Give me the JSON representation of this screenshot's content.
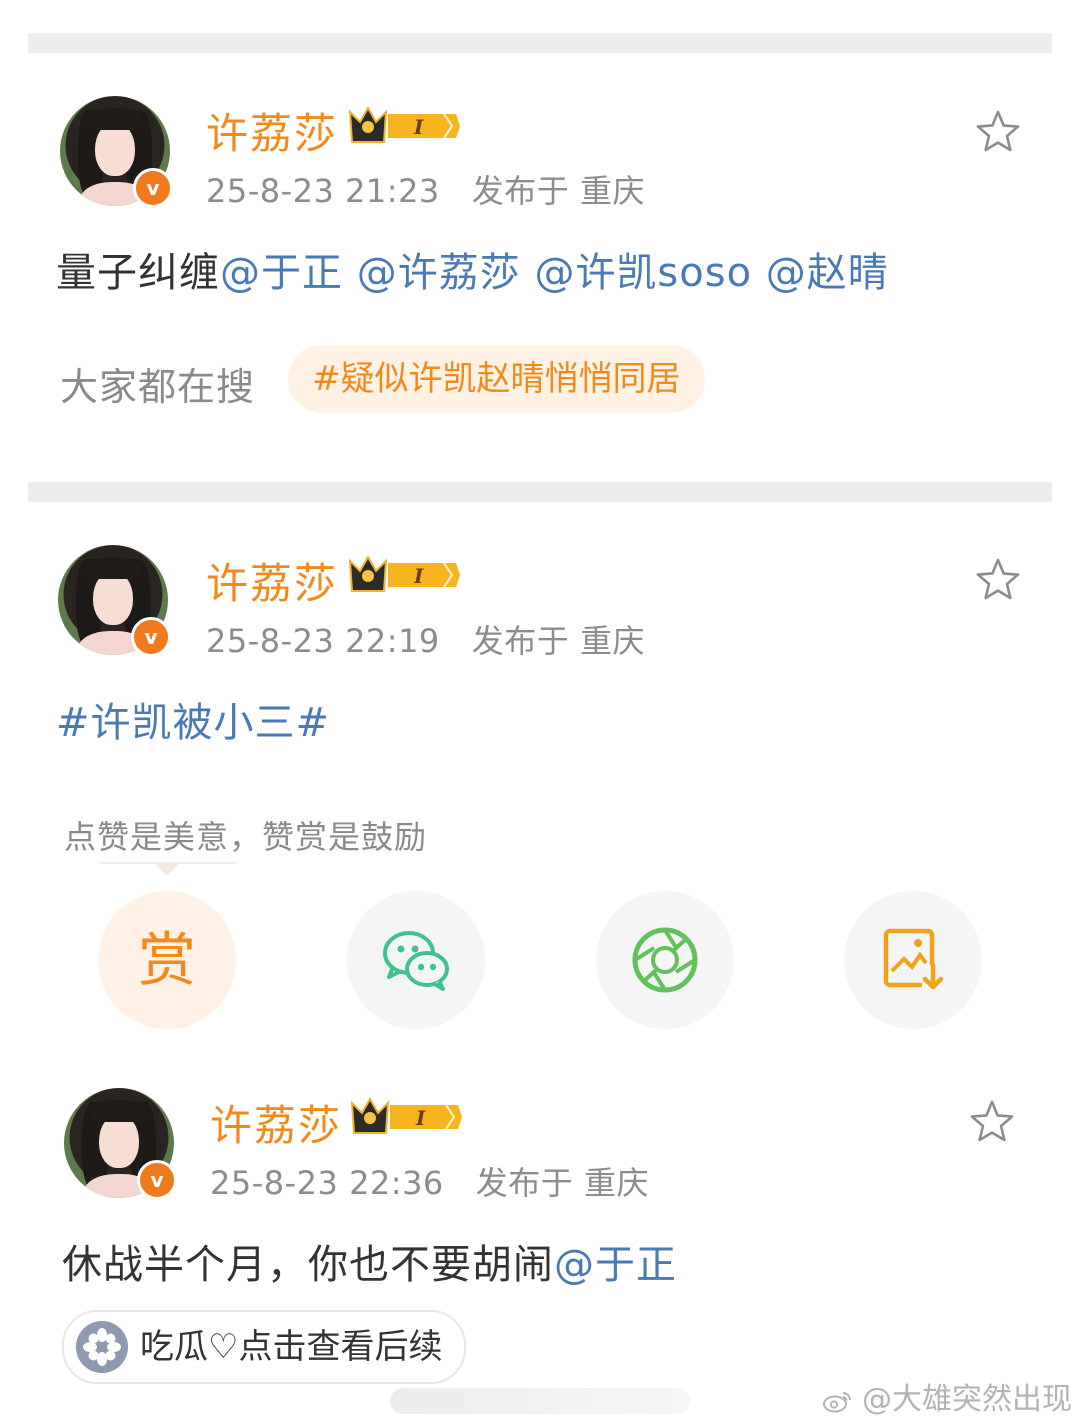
{
  "posts": [
    {
      "username": "许荔莎",
      "badge_level": "I",
      "verified_mark": "v",
      "timestamp": "25-8-23 21:23",
      "location": "发布于 重庆",
      "content_plain": "量子纠缠",
      "mentions": [
        "@于正",
        "@许荔莎",
        "@许凯soso",
        "@赵晴"
      ],
      "search_label": "大家都在搜",
      "search_topic": "#疑似许凯赵晴悄悄同居"
    },
    {
      "username": "许荔莎",
      "badge_level": "I",
      "verified_mark": "v",
      "timestamp": "25-8-23 22:19",
      "location": "发布于 重庆",
      "hashtag": "#许凯被小三#",
      "reward_tip": "点赞是美意，赞赏是鼓励",
      "reward_label": "赏"
    },
    {
      "username": "许荔莎",
      "badge_level": "I",
      "verified_mark": "v",
      "timestamp": "25-8-23 22:36",
      "location": "发布于 重庆",
      "content_plain": "休战半个月，你也不要胡闹",
      "mention": "@于正",
      "melon_label": "吃瓜♡点击查看后续"
    }
  ],
  "watermark": "@大雄突然出现",
  "icons": {
    "favorite": "star-outline-icon",
    "wechat": "wechat-icon",
    "moments": "moments-aperture-icon",
    "save_image": "save-image-icon",
    "melon": "melon-icon",
    "weibo": "weibo-logo-icon"
  },
  "colors": {
    "username": "#f08a1c",
    "mention": "#4a7ab5",
    "verified": "#f07a1c",
    "wechat": "#3ec28f",
    "moments": "#62c15b"
  }
}
